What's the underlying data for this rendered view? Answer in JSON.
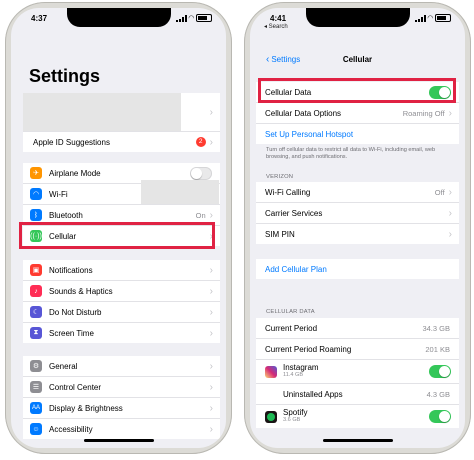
{
  "left": {
    "time": "4:37",
    "title": "Settings",
    "apple_id_suggestions": {
      "label": "Apple ID Suggestions",
      "badge": "2"
    },
    "connectivity": [
      {
        "label": "Airplane Mode",
        "icon": "airplane-icon",
        "color": "#ff9500"
      },
      {
        "label": "Wi-Fi",
        "icon": "wifi-icon",
        "color": "#007aff"
      },
      {
        "label": "Bluetooth",
        "icon": "bluetooth-icon",
        "color": "#007aff",
        "value": "On"
      },
      {
        "label": "Cellular",
        "icon": "cellular-icon",
        "color": "#34c759"
      }
    ],
    "system_group": [
      {
        "label": "Notifications",
        "icon": "notifications-icon",
        "color": "#ff3b30"
      },
      {
        "label": "Sounds & Haptics",
        "icon": "sound-icon",
        "color": "#ff2d55"
      },
      {
        "label": "Do Not Disturb",
        "icon": "moon-icon",
        "color": "#5856d6"
      },
      {
        "label": "Screen Time",
        "icon": "hourglass-icon",
        "color": "#5856d6"
      }
    ],
    "general_group": [
      {
        "label": "General",
        "icon": "gear-icon",
        "color": "#8e8e93"
      },
      {
        "label": "Control Center",
        "icon": "control-center-icon",
        "color": "#8e8e93"
      },
      {
        "label": "Display & Brightness",
        "icon": "display-icon",
        "color": "#007aff"
      },
      {
        "label": "Accessibility",
        "icon": "accessibility-icon",
        "color": "#007aff"
      }
    ]
  },
  "right": {
    "time": "4:41",
    "back_app": "◂ Search",
    "back_label": "Settings",
    "title": "Cellular",
    "cellular_data": "Cellular Data",
    "cellular_data_options": {
      "label": "Cellular Data Options",
      "value": "Roaming Off"
    },
    "hotspot": "Set Up Personal Hotspot",
    "note": "Turn off cellular data to restrict all data to Wi-Fi, including email, web browsing, and push notifications.",
    "verizon_header": "VERIZON",
    "carrier_rows": [
      {
        "label": "Wi-Fi Calling",
        "value": "Off"
      },
      {
        "label": "Carrier Services",
        "value": ""
      },
      {
        "label": "SIM PIN",
        "value": ""
      }
    ],
    "add_plan": "Add Cellular Plan",
    "usage_header": "CELLULAR DATA",
    "usage_rows": [
      {
        "label": "Current Period",
        "value": "34.3 GB"
      },
      {
        "label": "Current Period Roaming",
        "value": "201 KB"
      }
    ],
    "apps": [
      {
        "name": "Instagram",
        "size": "11.4 GB",
        "icon": "instagram-icon",
        "color": "#c13584"
      },
      {
        "name": "Uninstalled Apps",
        "value": "4.3 GB"
      },
      {
        "name": "Spotify",
        "size": "3.6 GB",
        "icon": "spotify-icon",
        "color": "#1db954"
      }
    ]
  }
}
